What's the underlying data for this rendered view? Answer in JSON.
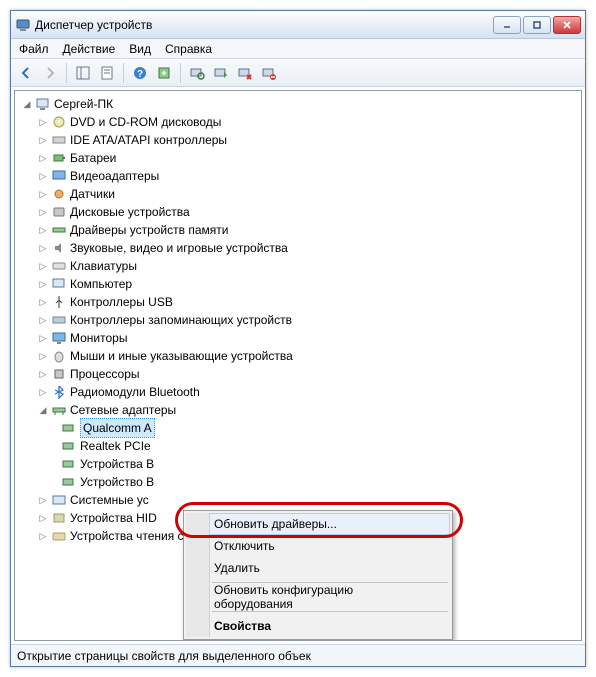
{
  "window": {
    "title": "Диспетчер устройств"
  },
  "menu": {
    "file": "Файл",
    "action": "Действие",
    "view": "Вид",
    "help": "Справка"
  },
  "tree": {
    "root": "Сергей-ПК",
    "cat_dvd": "DVD и CD-ROM дисководы",
    "cat_ide": "IDE ATA/ATAPI контроллеры",
    "cat_battery": "Батареи",
    "cat_video": "Видеоадаптеры",
    "cat_sensors": "Датчики",
    "cat_disk": "Дисковые устройства",
    "cat_memdrv": "Драйверы устройств памяти",
    "cat_sound": "Звуковые, видео и игровые устройства",
    "cat_keyboard": "Клавиатуры",
    "cat_computer": "Компьютер",
    "cat_usb": "Контроллеры USB",
    "cat_storage": "Контроллеры запоминающих устройств",
    "cat_monitor": "Мониторы",
    "cat_mouse": "Мыши и иные указывающие устройства",
    "cat_cpu": "Процессоры",
    "cat_bluetooth": "Радиомодули Bluetooth",
    "cat_network": "Сетевые адаптеры",
    "dev_qualcomm": "Qualcomm A",
    "dev_realtek": "Realtek PCIe",
    "dev_bt1": "Устройства B",
    "dev_bt2": "Устройство B",
    "cat_system": "Системные ус",
    "cat_hid": "Устройства HID",
    "cat_other": "Устройства чтения смарт-карт"
  },
  "context_menu": {
    "update": "Обновить драйверы...",
    "disable": "Отключить",
    "uninstall": "Удалить",
    "scan": "Обновить конфигурацию оборудования",
    "properties": "Свойства"
  },
  "status": {
    "text": "Открытие страницы свойств для выделенного объек"
  },
  "icons": {
    "computer": "computer-icon",
    "network": "network-icon",
    "generic": "device-icon"
  }
}
